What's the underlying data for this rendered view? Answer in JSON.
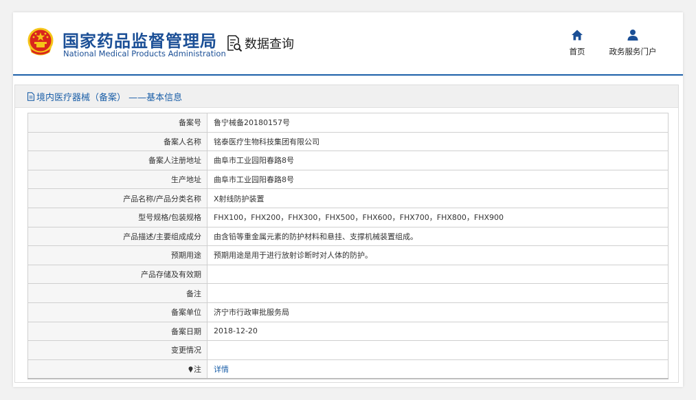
{
  "header": {
    "org_name_cn": "国家药品监督管理局",
    "org_name_en": "National Medical Products Administration",
    "query_label": "数据查询",
    "nav": [
      {
        "label": "首页",
        "icon": "home-icon"
      },
      {
        "label": "政务服务门户",
        "icon": "user-icon"
      }
    ]
  },
  "panel": {
    "title": "境内医疗器械（备案） ——基本信息"
  },
  "record": {
    "filing_no": {
      "label": "备案号",
      "value": "鲁宁械备20180157号"
    },
    "filer_name": {
      "label": "备案人名称",
      "value": "铭泰医疗生物科技集团有限公司"
    },
    "filer_address": {
      "label": "备案人注册地址",
      "value": "曲阜市工业园阳春路8号"
    },
    "production_address": {
      "label": "生产地址",
      "value": "曲阜市工业园阳春路8号"
    },
    "product_name": {
      "label": "产品名称/产品分类名称",
      "value": "X射线防护装置"
    },
    "model_spec": {
      "label": "型号规格/包装规格",
      "value": "FHX100，FHX200，FHX300，FHX500，FHX600，FHX700，FHX800，FHX900"
    },
    "description": {
      "label": "产品描述/主要组成成分",
      "value": "由含铅等重金属元素的防护材料和悬挂、支撑机械装置组成。"
    },
    "intended_use": {
      "label": "预期用途",
      "value": "预期用途是用于进行放射诊断时对人体的防护。"
    },
    "storage": {
      "label": "产品存储及有效期",
      "value": ""
    },
    "remarks": {
      "label": "备注",
      "value": ""
    },
    "filing_unit": {
      "label": "备案单位",
      "value": "济宁市行政审批服务局"
    },
    "filing_date": {
      "label": "备案日期",
      "value": "2018-12-20"
    },
    "changes": {
      "label": "变更情况",
      "value": ""
    },
    "note": {
      "label": "注",
      "value": "详情"
    }
  },
  "colors": {
    "brand_blue": "#1b4f96",
    "link_blue": "#1b5fa8",
    "emblem_red": "#d9261c",
    "emblem_gold": "#f5c518"
  }
}
